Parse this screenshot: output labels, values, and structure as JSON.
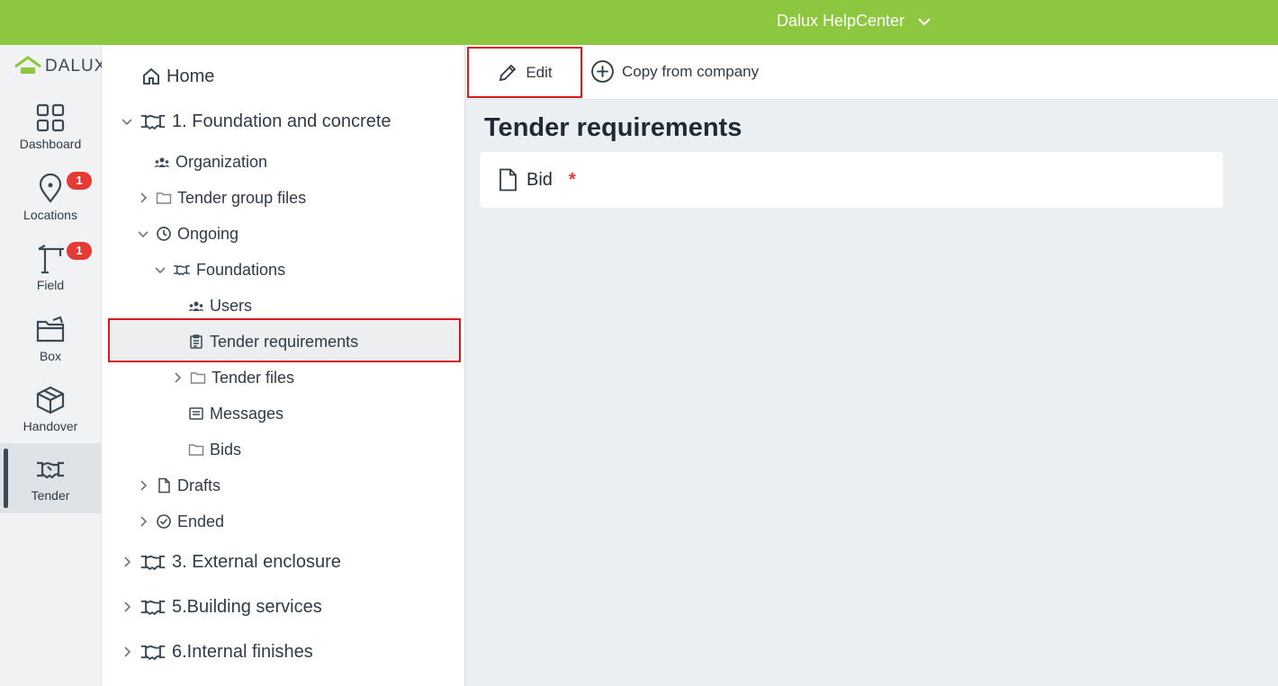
{
  "topbar": {
    "help_label": "Dalux HelpCenter"
  },
  "rail": {
    "logo_text": "DALUX",
    "items": [
      {
        "label": "Dashboard",
        "icon": "dashboard-icon"
      },
      {
        "label": "Locations",
        "icon": "location-pin-icon",
        "badge": "1"
      },
      {
        "label": "Field",
        "icon": "crane-icon",
        "badge": "1"
      },
      {
        "label": "Box",
        "icon": "folder-icon"
      },
      {
        "label": "Handover",
        "icon": "box-icon"
      },
      {
        "label": "Tender",
        "icon": "handshake-icon",
        "active": true
      }
    ]
  },
  "tree": {
    "home": "Home",
    "groups": [
      "1. Foundation and concrete",
      "3. External enclosure",
      "5.Building services",
      "6.Internal finishes"
    ],
    "organization": "Organization",
    "tender_group_files": "Tender group files",
    "ongoing": "Ongoing",
    "foundations": "Foundations",
    "users": "Users",
    "tender_requirements": "Tender requirements",
    "tender_files": "Tender files",
    "messages": "Messages",
    "bids": "Bids",
    "drafts": "Drafts",
    "ended": "Ended"
  },
  "toolbar": {
    "edit_label": "Edit",
    "copy_label": "Copy from company"
  },
  "main": {
    "title": "Tender requirements",
    "requirement": {
      "label": "Bid",
      "required_mark": "*"
    }
  },
  "colors": {
    "brand_green": "#8dc63f",
    "badge_red": "#e53935",
    "highlight_red": "#d7191f"
  }
}
